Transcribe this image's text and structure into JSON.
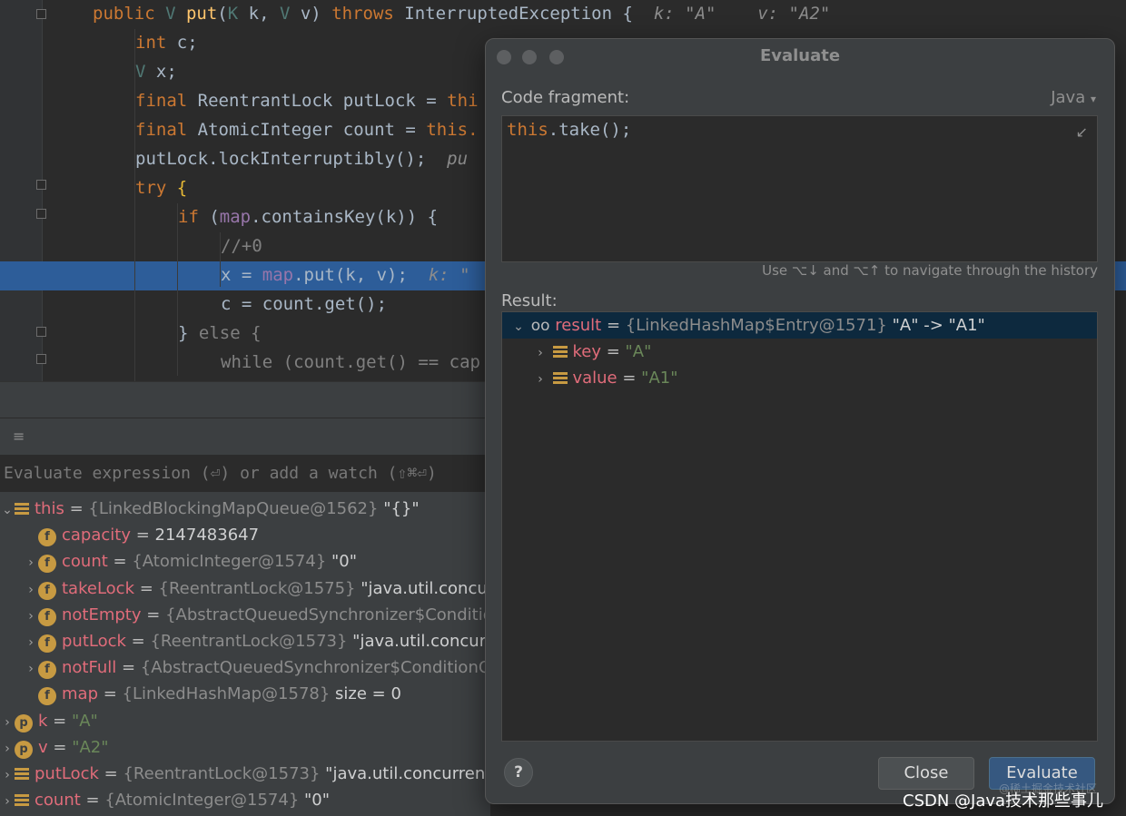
{
  "editor": {
    "lines": [
      {
        "parts": [
          [
            "kw",
            "public "
          ],
          [
            "tv",
            "V "
          ],
          [
            "fn",
            "put"
          ],
          [
            "tp",
            "("
          ],
          [
            "tv",
            "K "
          ],
          [
            "tp",
            "k, "
          ],
          [
            "tv",
            "V "
          ],
          [
            "tp",
            "v) "
          ],
          [
            "kw",
            "throws "
          ],
          [
            "tp",
            "InterruptedException "
          ],
          [
            "tp",
            "{  "
          ],
          [
            "hint",
            "k: \"A\"    v: \"A2\""
          ]
        ]
      },
      {
        "parts": [
          [
            "kw",
            "int "
          ],
          [
            "tp",
            "c;"
          ]
        ]
      },
      {
        "parts": [
          [
            "tv",
            "V "
          ],
          [
            "tp",
            "x;"
          ]
        ]
      },
      {
        "parts": [
          [
            "kw",
            "final "
          ],
          [
            "tp",
            "ReentrantLock putLock = "
          ],
          [
            "kw",
            "thi"
          ]
        ]
      },
      {
        "parts": [
          [
            "kw",
            "final "
          ],
          [
            "tp",
            "AtomicInteger count = "
          ],
          [
            "kw",
            "this."
          ]
        ]
      },
      {
        "parts": [
          [
            "tp",
            "putLock.lockInterruptibly();  "
          ],
          [
            "hint",
            "pu"
          ]
        ]
      },
      {
        "parts": [
          [
            "kw",
            "try "
          ],
          [
            "br",
            "{"
          ]
        ]
      },
      {
        "parts": [
          [
            "kw",
            "if "
          ],
          [
            "tp",
            "("
          ],
          [
            "fld",
            "map"
          ],
          [
            "tp",
            ".containsKey(k)) {"
          ]
        ]
      },
      {
        "parts": [
          [
            "cm",
            "//+0"
          ]
        ]
      },
      {
        "parts": [
          [
            "tp",
            "x = "
          ],
          [
            "fld",
            "map"
          ],
          [
            "tp",
            ".put(k, v);  "
          ],
          [
            "hint",
            "k: \""
          ]
        ]
      },
      {
        "parts": [
          [
            "tp",
            "c = count.get();"
          ]
        ]
      },
      {
        "parts": [
          [
            "tp",
            "} "
          ],
          [
            "cm",
            "else {"
          ]
        ]
      },
      {
        "parts": [
          [
            "cm",
            "while (count.get() == cap"
          ]
        ]
      }
    ]
  },
  "debugger": {
    "eval_placeholder": "Evaluate expression (⏎) or add a watch (⇧⌘⏎)",
    "variables": [
      {
        "arrow": "⌄",
        "icon": "bars",
        "name": "this",
        "ref": "{LinkedBlockingMapQueue@1562}",
        "val": "\"{}\""
      },
      {
        "arrow": "",
        "icon": "f",
        "name": "capacity",
        "ref": "",
        "val": "2147483647"
      },
      {
        "arrow": "›",
        "icon": "f",
        "name": "count",
        "ref": "{AtomicInteger@1574}",
        "val": "\"0\""
      },
      {
        "arrow": "›",
        "icon": "f",
        "name": "takeLock",
        "ref": "{ReentrantLock@1575}",
        "val": "\"java.util.concur"
      },
      {
        "arrow": "›",
        "icon": "f",
        "name": "notEmpty",
        "ref": "{AbstractQueuedSynchronizer$Conditio",
        "val": ""
      },
      {
        "arrow": "›",
        "icon": "f",
        "name": "putLock",
        "ref": "{ReentrantLock@1573}",
        "val": "\"java.util.concurr"
      },
      {
        "arrow": "›",
        "icon": "f",
        "name": "notFull",
        "ref": "{AbstractQueuedSynchronizer$ConditionO",
        "val": ""
      },
      {
        "arrow": "",
        "icon": "f",
        "name": "map",
        "ref": "{LinkedHashMap@1578}",
        "val": " size = 0"
      },
      {
        "arrow": "›",
        "icon": "p",
        "name": "k",
        "ref": "",
        "val": "\"A\""
      },
      {
        "arrow": "›",
        "icon": "p",
        "name": "v",
        "ref": "",
        "val": "\"A2\""
      },
      {
        "arrow": "›",
        "icon": "bars",
        "name": "putLock",
        "ref": "{ReentrantLock@1573}",
        "val": "\"java.util.concurrent"
      },
      {
        "arrow": "›",
        "icon": "bars",
        "name": "count",
        "ref": "{AtomicInteger@1574}",
        "val": "\"0\""
      }
    ]
  },
  "dialog": {
    "title": "Evaluate",
    "code_fragment_label": "Code fragment:",
    "language": "Java",
    "code_prefix": "this",
    "code_rest": ".take();",
    "history_hint": "Use ⌥↓ and ⌥↑ to navigate through the history",
    "result_label": "Result:",
    "result_name": "result",
    "result_ref": "{LinkedHashMap$Entry@1571}",
    "result_val": "\"A\" -> \"A1\"",
    "children": [
      {
        "name": "key",
        "val": "\"A\""
      },
      {
        "name": "value",
        "val": "\"A1\""
      }
    ],
    "close_label": "Close",
    "evaluate_label": "Evaluate"
  },
  "watermark": {
    "faint": "@稀土掘金技术社区",
    "main": "CSDN @Java技术那些事儿"
  }
}
